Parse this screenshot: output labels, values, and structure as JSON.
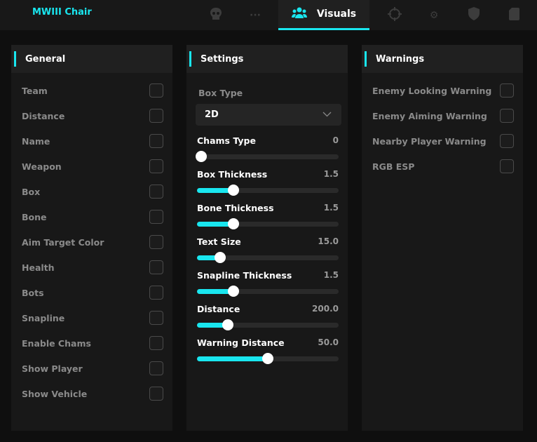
{
  "app": {
    "title": "MWIII Chair",
    "accent": "#19e6ef"
  },
  "tabs": [
    {
      "icon": "skull-icon"
    },
    {
      "icon": "more-icon"
    },
    {
      "icon": "users-icon",
      "label": "Visuals",
      "active": true
    },
    {
      "icon": "crosshair-icon"
    },
    {
      "icon": "gear-icon"
    },
    {
      "icon": "shield-icon"
    },
    {
      "icon": "file-icon"
    }
  ],
  "general": {
    "title": "General",
    "items": [
      "Team",
      "Distance",
      "Name",
      "Weapon",
      "Box",
      "Bone",
      "Aim Target Color",
      "Health",
      "Bots",
      "Snapline",
      "Enable Chams",
      "Show Player",
      "Show Vehicle"
    ]
  },
  "settings": {
    "title": "Settings",
    "box_type_label": "Box Type",
    "box_type_value": "2D",
    "sliders": [
      {
        "label": "Chams Type",
        "value": "0",
        "fraction": 0
      },
      {
        "label": "Box Thickness",
        "value": "1.5",
        "fraction": 0.24
      },
      {
        "label": "Bone Thickness",
        "value": "1.5",
        "fraction": 0.24
      },
      {
        "label": "Text Size",
        "value": "15.0",
        "fraction": 0.14
      },
      {
        "label": "Snapline Thickness",
        "value": "1.5",
        "fraction": 0.24
      },
      {
        "label": "Distance",
        "value": "200.0",
        "fraction": 0.2
      },
      {
        "label": "Warning Distance",
        "value": "50.0",
        "fraction": 0.5
      }
    ]
  },
  "warnings": {
    "title": "Warnings",
    "items": [
      "Enemy Looking Warning",
      "Enemy Aiming Warning",
      "Nearby Player Warning",
      "RGB ESP"
    ]
  }
}
